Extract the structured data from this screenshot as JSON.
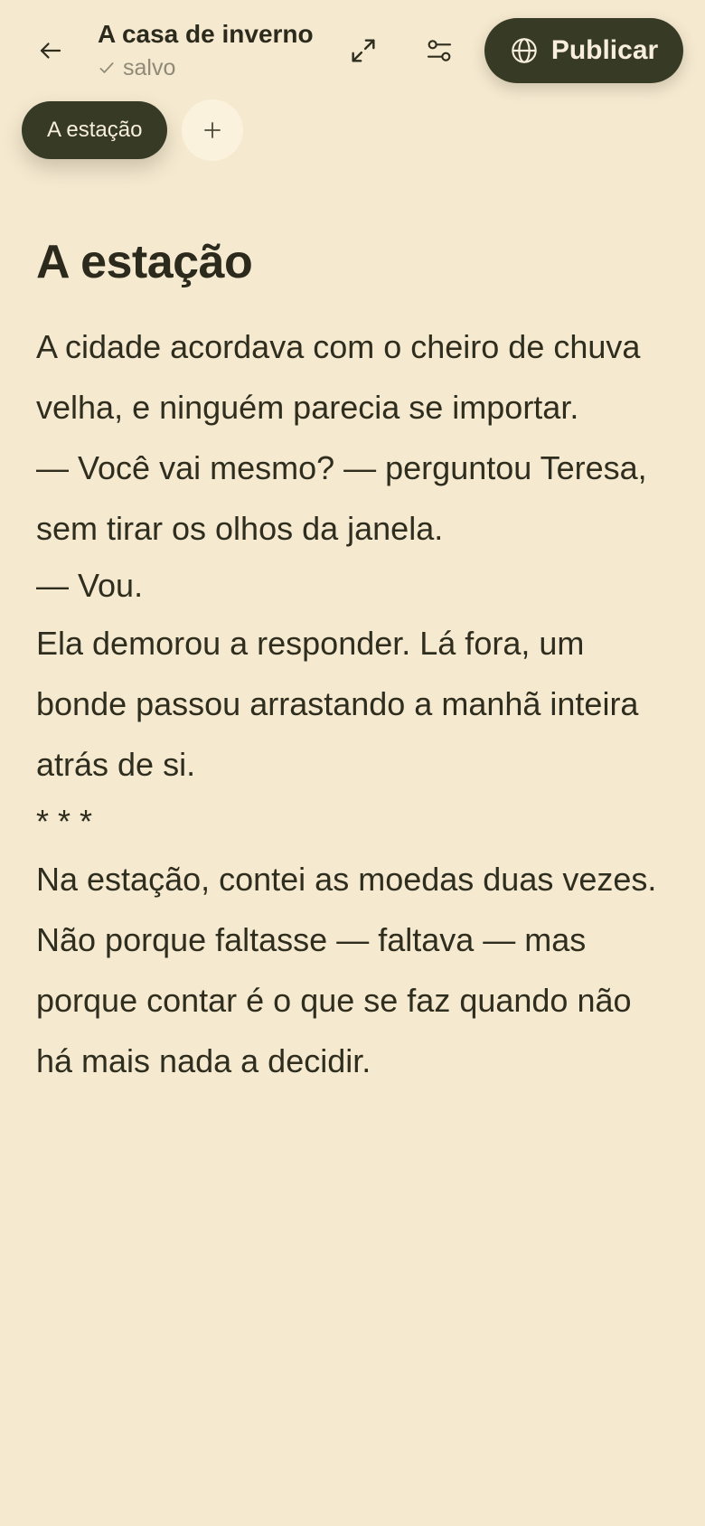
{
  "header": {
    "title": "A casa de inverno",
    "status": "salvo",
    "publish_label": "Publicar"
  },
  "icons": {
    "back": "arrow-left-icon",
    "saved": "check-icon",
    "expand": "expand-icon",
    "settings": "sliders-icon",
    "publish": "globe-icon",
    "add": "plus-icon"
  },
  "chapters": {
    "items": [
      {
        "label": "A estação",
        "active": true
      }
    ]
  },
  "document": {
    "heading": "A estação",
    "paragraphs": [
      "A cidade acordava com o cheiro de chuva velha, e ninguém parecia se importar.",
      "— Você vai mesmo? — perguntou Teresa, sem tirar os olhos da janela.",
      "— Vou.",
      "Ela demorou a responder. Lá fora, um bonde passou arrastando a manhã inteira atrás de si.",
      "* * *",
      "Na estação, contei as moedas duas vezes. Não porque faltasse — faltava — mas porque contar é o que se faz quando não há mais nada a decidir."
    ]
  },
  "colors": {
    "background": "#F5E9D0",
    "accent": "#373A25",
    "text": "#2E2D1E",
    "muted": "#8F8A76",
    "chip_add_bg": "#FBF2DE"
  }
}
